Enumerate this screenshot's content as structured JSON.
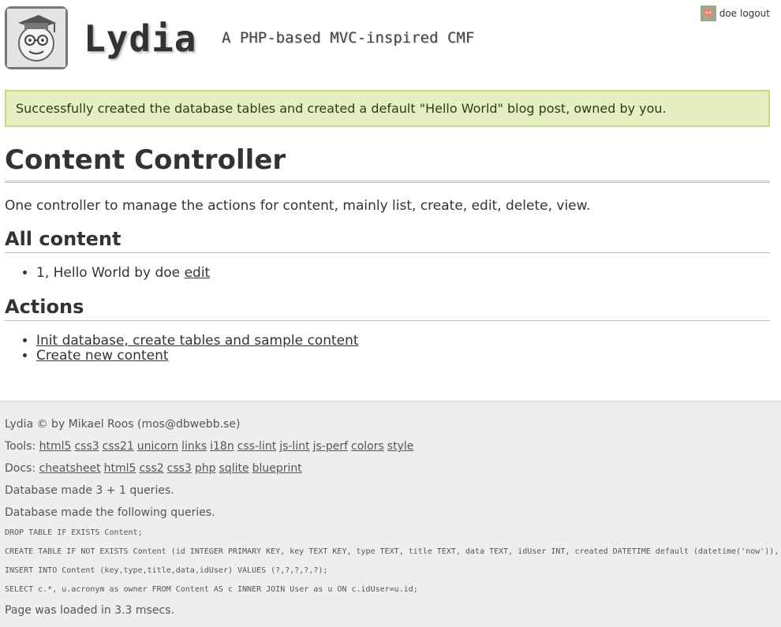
{
  "header": {
    "site_title": "Lydia",
    "slogan": "A PHP-based MVC-inspired CMF",
    "login": {
      "username": "doe",
      "logout_label": "logout"
    }
  },
  "flash": {
    "message": "Successfully created the database tables and created a default \"Hello World\" blog post, owned by you."
  },
  "page": {
    "title": "Content Controller",
    "description": "One controller to manage the actions for content, mainly list, create, edit, delete, view."
  },
  "all_content": {
    "heading": "All content",
    "items": [
      {
        "text": "1, Hello World by doe",
        "edit_label": "edit"
      }
    ]
  },
  "actions": {
    "heading": "Actions",
    "links": [
      {
        "label": "Init database, create tables and sample content"
      },
      {
        "label": "Create new content"
      }
    ]
  },
  "footer": {
    "copyright": "Lydia © by Mikael Roos (mos@dbwebb.se)",
    "tools_label": "Tools:",
    "tools": [
      "html5",
      "css3",
      "css21",
      "unicorn",
      "links",
      "i18n",
      "css-lint",
      "js-lint",
      "js-perf",
      "colors",
      "style"
    ],
    "docs_label": "Docs:",
    "docs": [
      "cheatsheet",
      "html5",
      "css2",
      "css3",
      "php",
      "sqlite",
      "blueprint"
    ],
    "db_count": "Database made 3 + 1 queries.",
    "db_queries_label": "Database made the following queries.",
    "queries": [
      "DROP TABLE IF EXISTS Content;",
      "CREATE TABLE IF NOT EXISTS Content (id INTEGER PRIMARY KEY, key TEXT KEY, type TEXT, title TEXT, data TEXT, idUser INT, created DATETIME default (datetime('now')),",
      "INSERT INTO Content (key,type,title,data,idUser) VALUES (?,?,?,?,?);",
      "SELECT c.*, u.acronym as owner FROM Content AS c INNER JOIN User as u ON c.idUser=u.id;"
    ],
    "load_time": "Page was loaded in 3.3 msecs."
  },
  "icons": {
    "logo": "lydia-logo-icon",
    "avatar": "gravatar-icon"
  },
  "colors": {
    "flash_bg": "#e6efc2",
    "flash_border": "#c6d880",
    "footer_bg": "#eeeeee"
  }
}
